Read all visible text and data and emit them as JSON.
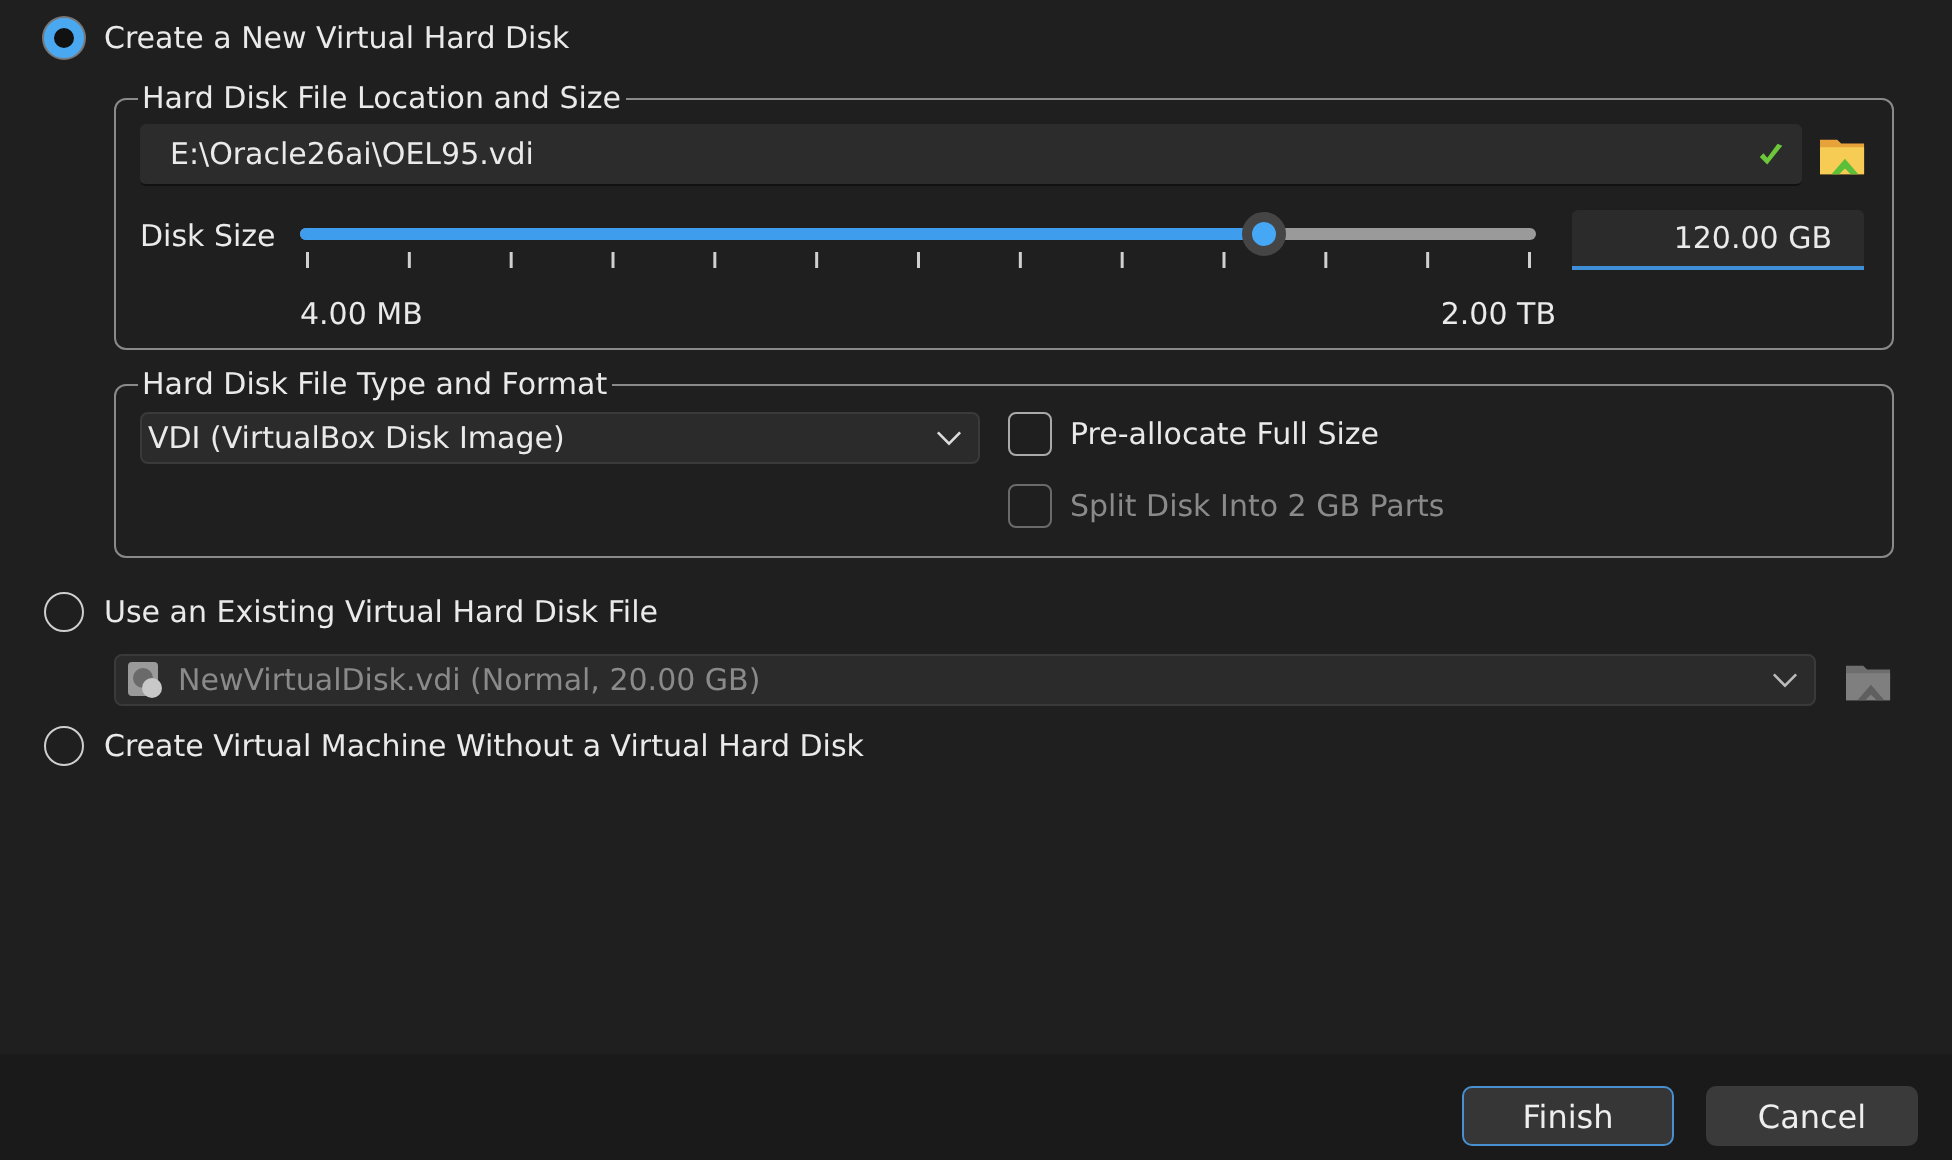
{
  "options": [
    {
      "label": "Create a New Virtual Hard Disk",
      "selected": true
    },
    {
      "label": "Use an Existing Virtual Hard Disk File",
      "selected": false
    },
    {
      "label": "Create Virtual Machine Without a Virtual Hard Disk",
      "selected": false
    }
  ],
  "location_group": {
    "title": "Hard Disk File Location and Size",
    "path": "E:\\Oracle26ai\\OEL95.vdi",
    "disk_size_label": "Disk Size",
    "level": 0.78,
    "min_label": "4.00 MB",
    "max_label": "2.00 TB",
    "size_value": "120.00 GB"
  },
  "format_group": {
    "title": "Hard Disk File Type and Format",
    "format": "VDI (VirtualBox Disk Image)",
    "checkboxes": [
      {
        "label": "Pre-allocate Full Size",
        "checked": false,
        "disabled": false
      },
      {
        "label": "Split Disk Into 2 GB Parts",
        "checked": false,
        "disabled": true
      }
    ]
  },
  "existing_disk": {
    "value": "NewVirtualDisk.vdi (Normal, 20.00 GB)",
    "disabled": true
  },
  "buttons": [
    {
      "label": "Finish",
      "selected": true
    },
    {
      "label": "Cancel",
      "selected": false
    }
  ]
}
